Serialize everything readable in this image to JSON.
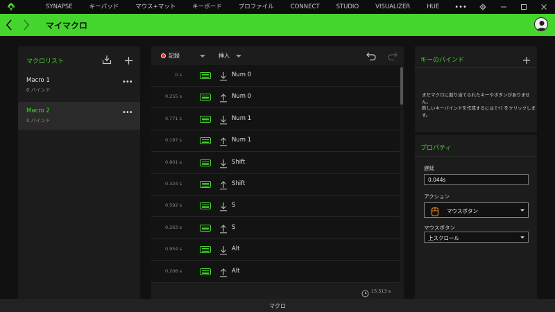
{
  "nav": {
    "items": [
      "SYNAPSE",
      "キーパッド",
      "マウス+マット",
      "キーボード",
      "プロファイル",
      "CONNECT",
      "STUDIO",
      "VISUALIZER",
      "HUE"
    ],
    "more": "•••"
  },
  "header": {
    "title": "マイマクロ"
  },
  "macro_list": {
    "title": "マクロリスト",
    "items": [
      {
        "name": "Macro 1",
        "sub": "0 バインド",
        "selected": false
      },
      {
        "name": "Macro 2",
        "sub": "0 バインド",
        "selected": true
      }
    ]
  },
  "editor": {
    "record_label": "記録",
    "insert_label": "挿入",
    "rows": [
      {
        "time": "0 s",
        "dir": "down",
        "key": "Num 0"
      },
      {
        "time": "0.255 s",
        "dir": "up",
        "key": "Num 0"
      },
      {
        "time": "0.771 s",
        "dir": "down",
        "key": "Num 1"
      },
      {
        "time": "0.197 s",
        "dir": "up",
        "key": "Num 1"
      },
      {
        "time": "0.801 s",
        "dir": "down",
        "key": "Shift"
      },
      {
        "time": "0.324 s",
        "dir": "up",
        "key": "Shift"
      },
      {
        "time": "0.592 s",
        "dir": "down",
        "key": "S"
      },
      {
        "time": "0.263 s",
        "dir": "up",
        "key": "S"
      },
      {
        "time": "0.954 s",
        "dir": "down",
        "key": "Alt"
      },
      {
        "time": "0.206 s",
        "dir": "up",
        "key": "Alt"
      }
    ],
    "total_time": "15.513 s"
  },
  "key_bind": {
    "title": "キーのバインド",
    "line1": "まだマクロに割り当てられたキーやボタンがありません。",
    "line2": "新しいキーバインドを作成するには [+] をクリックします。"
  },
  "properties": {
    "title": "プロパティ",
    "delay_label": "遅延",
    "delay_value": "0.044s",
    "action_label": "アクション",
    "action_value": "マウスボタン",
    "mouse_button_label": "マウスボタン",
    "mouse_button_value": "上スクロール"
  },
  "footer": {
    "label": "マクロ"
  },
  "colors": {
    "accent": "#44d62c",
    "background": "#111111",
    "panel": "#1c1c1c"
  }
}
